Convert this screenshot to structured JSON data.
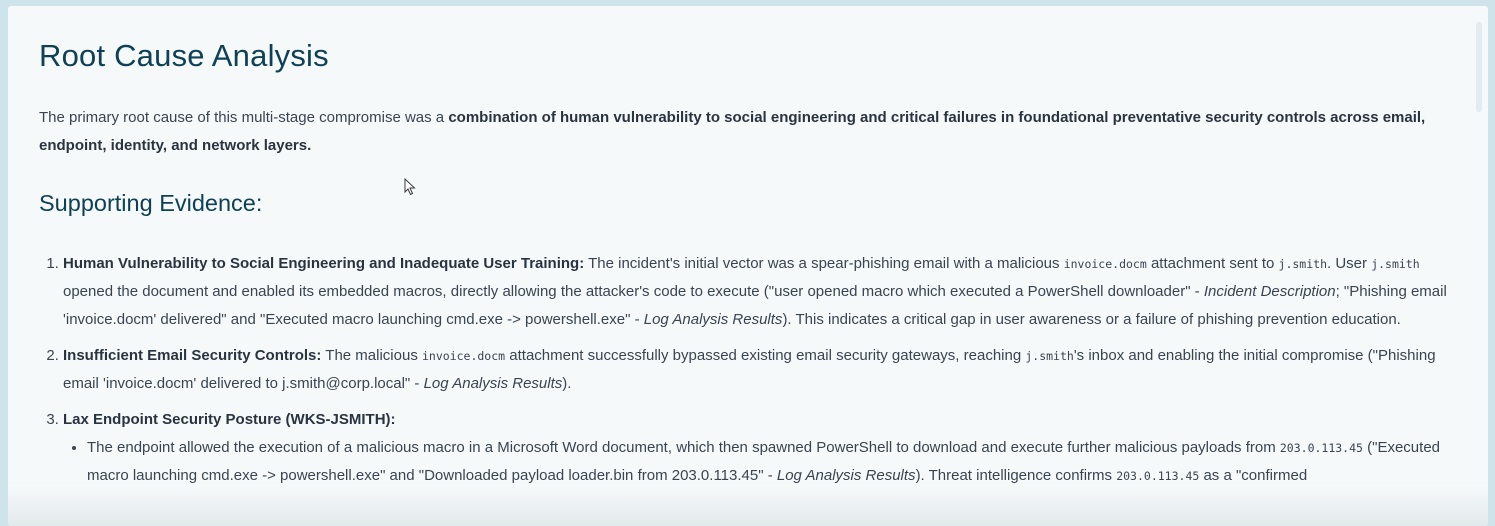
{
  "title": "Root Cause Analysis",
  "intro": {
    "prefix": "The primary root cause of this multi-stage compromise was a ",
    "bold": "combination of human vulnerability to social engineering and critical failures in foundational preventative security controls across email, endpoint, identity, and network layers."
  },
  "section_heading": "Supporting Evidence:",
  "items": [
    {
      "heading": "Human Vulnerability to Social Engineering and Inadequate User Training:",
      "t1": " The incident's initial vector was a spear-phishing email with a malicious ",
      "code1": "invoice.docm",
      "t2": " attachment sent to ",
      "code2": "j.smith",
      "t3": ". User ",
      "code3": "j.smith",
      "t4": " opened the document and enabled its embedded macros, directly allowing the attacker's code to execute (\"user opened macro which executed a PowerShell downloader\" - ",
      "ital1": "Incident Description",
      "t5": "; \"Phishing email 'invoice.docm' delivered\" and \"Executed macro launching cmd.exe -> powershell.exe\" - ",
      "ital2": "Log Analysis Results",
      "t6": "). This indicates a critical gap in user awareness or a failure of phishing prevention education."
    },
    {
      "heading": "Insufficient Email Security Controls:",
      "t1": " The malicious ",
      "code1": "invoice.docm",
      "t2": " attachment successfully bypassed existing email security gateways, reaching ",
      "code2": "j.smith",
      "t3": "'s inbox and enabling the initial compromise (\"Phishing email 'invoice.docm' delivered to j.smith@corp.local\" - ",
      "ital1": "Log Analysis Results",
      "t4": ")."
    },
    {
      "heading": "Lax Endpoint Security Posture (WKS-JSMITH):",
      "bullets": [
        {
          "t1": "The endpoint allowed the execution of a malicious macro in a Microsoft Word document, which then spawned PowerShell to download and execute further malicious payloads from ",
          "code1": "203.0.113.45",
          "t2": " (\"Executed macro launching cmd.exe -> powershell.exe\" and \"Downloaded payload loader.bin from 203.0.113.45\" - ",
          "ital1": "Log Analysis Results",
          "t3": "). Threat intelligence confirms ",
          "code2": "203.0.113.45",
          "t4": " as a \"confirmed"
        }
      ]
    }
  ]
}
